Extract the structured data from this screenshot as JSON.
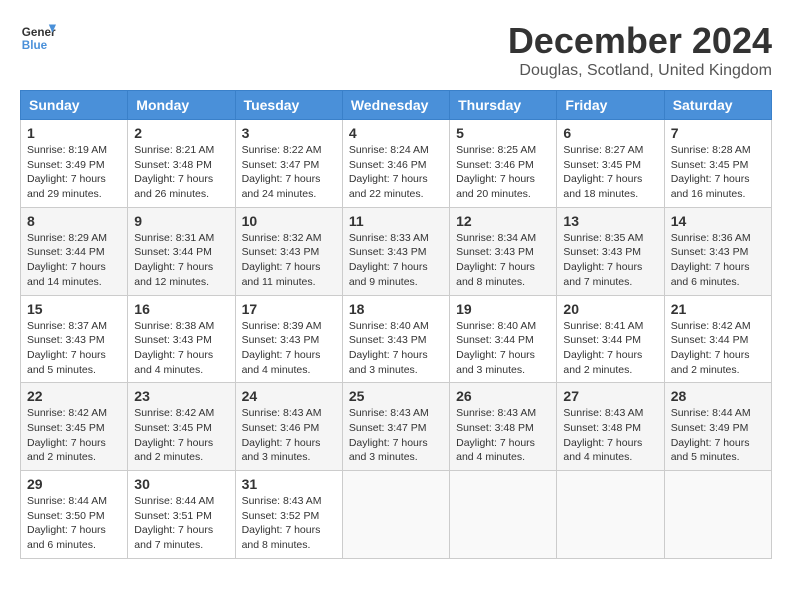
{
  "header": {
    "logo_general": "General",
    "logo_blue": "Blue",
    "month_title": "December 2024",
    "location": "Douglas, Scotland, United Kingdom"
  },
  "days_of_week": [
    "Sunday",
    "Monday",
    "Tuesday",
    "Wednesday",
    "Thursday",
    "Friday",
    "Saturday"
  ],
  "weeks": [
    [
      {
        "day": "1",
        "sunrise": "8:19 AM",
        "sunset": "3:49 PM",
        "daylight": "7 hours and 29 minutes."
      },
      {
        "day": "2",
        "sunrise": "8:21 AM",
        "sunset": "3:48 PM",
        "daylight": "7 hours and 26 minutes."
      },
      {
        "day": "3",
        "sunrise": "8:22 AM",
        "sunset": "3:47 PM",
        "daylight": "7 hours and 24 minutes."
      },
      {
        "day": "4",
        "sunrise": "8:24 AM",
        "sunset": "3:46 PM",
        "daylight": "7 hours and 22 minutes."
      },
      {
        "day": "5",
        "sunrise": "8:25 AM",
        "sunset": "3:46 PM",
        "daylight": "7 hours and 20 minutes."
      },
      {
        "day": "6",
        "sunrise": "8:27 AM",
        "sunset": "3:45 PM",
        "daylight": "7 hours and 18 minutes."
      },
      {
        "day": "7",
        "sunrise": "8:28 AM",
        "sunset": "3:45 PM",
        "daylight": "7 hours and 16 minutes."
      }
    ],
    [
      {
        "day": "8",
        "sunrise": "8:29 AM",
        "sunset": "3:44 PM",
        "daylight": "7 hours and 14 minutes."
      },
      {
        "day": "9",
        "sunrise": "8:31 AM",
        "sunset": "3:44 PM",
        "daylight": "7 hours and 12 minutes."
      },
      {
        "day": "10",
        "sunrise": "8:32 AM",
        "sunset": "3:43 PM",
        "daylight": "7 hours and 11 minutes."
      },
      {
        "day": "11",
        "sunrise": "8:33 AM",
        "sunset": "3:43 PM",
        "daylight": "7 hours and 9 minutes."
      },
      {
        "day": "12",
        "sunrise": "8:34 AM",
        "sunset": "3:43 PM",
        "daylight": "7 hours and 8 minutes."
      },
      {
        "day": "13",
        "sunrise": "8:35 AM",
        "sunset": "3:43 PM",
        "daylight": "7 hours and 7 minutes."
      },
      {
        "day": "14",
        "sunrise": "8:36 AM",
        "sunset": "3:43 PM",
        "daylight": "7 hours and 6 minutes."
      }
    ],
    [
      {
        "day": "15",
        "sunrise": "8:37 AM",
        "sunset": "3:43 PM",
        "daylight": "7 hours and 5 minutes."
      },
      {
        "day": "16",
        "sunrise": "8:38 AM",
        "sunset": "3:43 PM",
        "daylight": "7 hours and 4 minutes."
      },
      {
        "day": "17",
        "sunrise": "8:39 AM",
        "sunset": "3:43 PM",
        "daylight": "7 hours and 4 minutes."
      },
      {
        "day": "18",
        "sunrise": "8:40 AM",
        "sunset": "3:43 PM",
        "daylight": "7 hours and 3 minutes."
      },
      {
        "day": "19",
        "sunrise": "8:40 AM",
        "sunset": "3:44 PM",
        "daylight": "7 hours and 3 minutes."
      },
      {
        "day": "20",
        "sunrise": "8:41 AM",
        "sunset": "3:44 PM",
        "daylight": "7 hours and 2 minutes."
      },
      {
        "day": "21",
        "sunrise": "8:42 AM",
        "sunset": "3:44 PM",
        "daylight": "7 hours and 2 minutes."
      }
    ],
    [
      {
        "day": "22",
        "sunrise": "8:42 AM",
        "sunset": "3:45 PM",
        "daylight": "7 hours and 2 minutes."
      },
      {
        "day": "23",
        "sunrise": "8:42 AM",
        "sunset": "3:45 PM",
        "daylight": "7 hours and 2 minutes."
      },
      {
        "day": "24",
        "sunrise": "8:43 AM",
        "sunset": "3:46 PM",
        "daylight": "7 hours and 3 minutes."
      },
      {
        "day": "25",
        "sunrise": "8:43 AM",
        "sunset": "3:47 PM",
        "daylight": "7 hours and 3 minutes."
      },
      {
        "day": "26",
        "sunrise": "8:43 AM",
        "sunset": "3:48 PM",
        "daylight": "7 hours and 4 minutes."
      },
      {
        "day": "27",
        "sunrise": "8:43 AM",
        "sunset": "3:48 PM",
        "daylight": "7 hours and 4 minutes."
      },
      {
        "day": "28",
        "sunrise": "8:44 AM",
        "sunset": "3:49 PM",
        "daylight": "7 hours and 5 minutes."
      }
    ],
    [
      {
        "day": "29",
        "sunrise": "8:44 AM",
        "sunset": "3:50 PM",
        "daylight": "7 hours and 6 minutes."
      },
      {
        "day": "30",
        "sunrise": "8:44 AM",
        "sunset": "3:51 PM",
        "daylight": "7 hours and 7 minutes."
      },
      {
        "day": "31",
        "sunrise": "8:43 AM",
        "sunset": "3:52 PM",
        "daylight": "7 hours and 8 minutes."
      },
      null,
      null,
      null,
      null
    ]
  ],
  "labels": {
    "sunrise": "Sunrise:",
    "sunset": "Sunset:",
    "daylight": "Daylight:"
  }
}
